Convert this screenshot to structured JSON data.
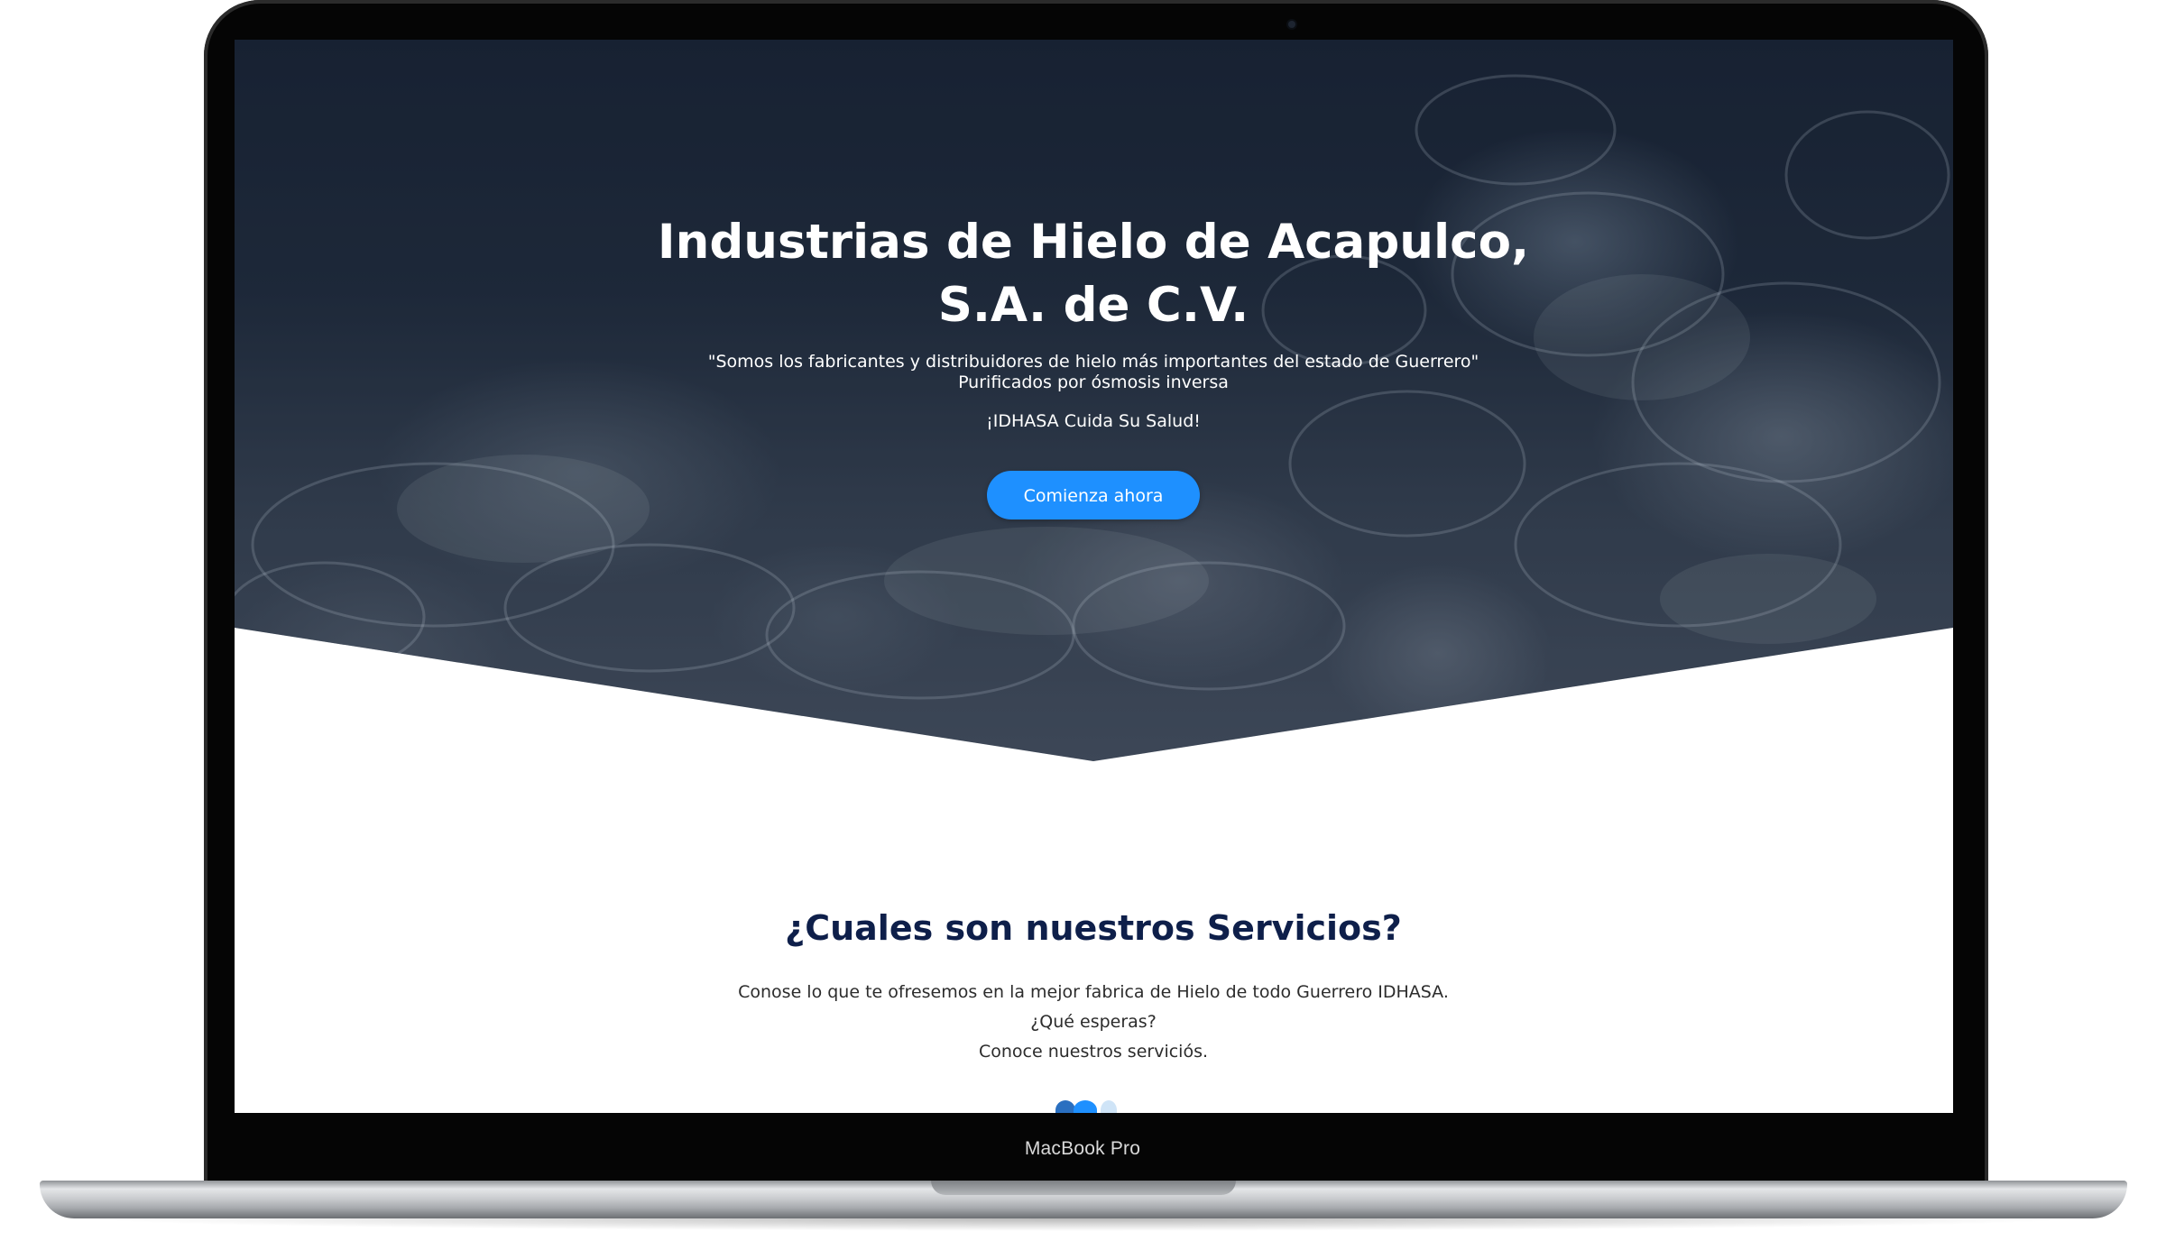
{
  "device": {
    "label": "MacBook Pro"
  },
  "hero": {
    "title_line1": "Industrias de Hielo de Acapulco,",
    "title_line2": "S.A. de C.V.",
    "subtitle_line1": "\"Somos los fabricantes y distribuidores de hielo más importantes del estado de Guerrero\"",
    "subtitle_line2": "Purificados por ósmosis inversa",
    "tagline": "¡IDHASA Cuida Su Salud!",
    "cta_label": "Comienza ahora"
  },
  "services": {
    "title": "¿Cuales son nuestros Servicios?",
    "line1": "Conose lo que te ofresemos en la mejor fabrica de Hielo de todo Guerrero IDHASA.",
    "line2": "¿Qué esperas?",
    "line3": "Conoce nuestros serviciós."
  },
  "colors": {
    "accent": "#1e90ff",
    "heading": "#0e1f4a",
    "hero_bg": "#222e3f"
  }
}
